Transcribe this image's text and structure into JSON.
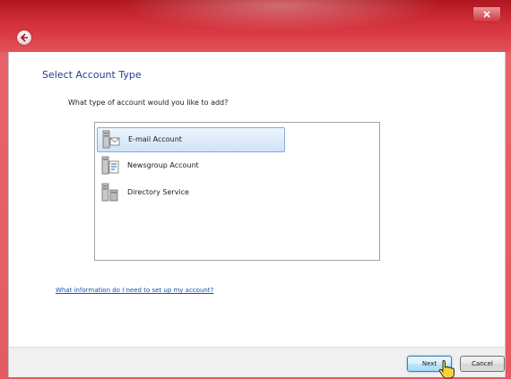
{
  "window": {
    "page_title": "Select Account Type",
    "question": "What type of account would you like to add?"
  },
  "account_types": [
    {
      "label": "E-mail Account",
      "icon": "email-account-icon",
      "selected": true
    },
    {
      "label": "Newsgroup Account",
      "icon": "newsgroup-account-icon",
      "selected": false
    },
    {
      "label": "Directory Service",
      "icon": "directory-service-icon",
      "selected": false
    }
  ],
  "help_link": "What information do I need to set up my account?",
  "buttons": {
    "next": "Next",
    "cancel": "Cancel"
  },
  "colors": {
    "title_bar": "#d23039",
    "page_title": "#1e3f8c",
    "link": "#1a52b0",
    "selection": "#cfe2f8"
  }
}
